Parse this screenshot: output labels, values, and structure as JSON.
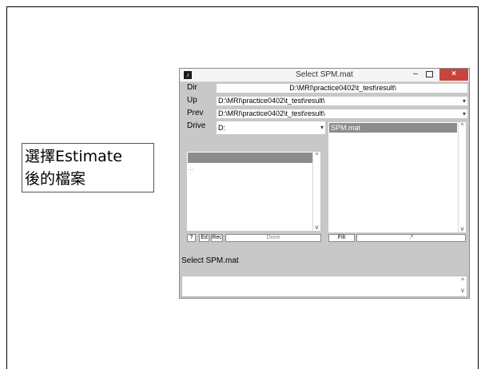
{
  "callout": {
    "line1": "選擇Estimate",
    "line2": "後的檔案"
  },
  "window": {
    "title": "Select SPM.mat",
    "icon": "matlab-icon",
    "controls": {
      "minimize": "–",
      "maximize": "□",
      "close": "×"
    }
  },
  "rows": {
    "dir_label": "Dir",
    "dir_value": "D:\\MRI\\practice0402\\t_test\\result\\",
    "up_label": "Up",
    "up_value": "D:\\MRI\\practice0402\\t_test\\result\\",
    "prev_label": "Prev",
    "prev_value": "D:\\MRI\\practice0402\\t_test\\result\\",
    "drive_label": "Drive",
    "drive_value": "D:"
  },
  "left_list": {
    "items": [
      "",
      ".."
    ]
  },
  "right_list": {
    "items": [
      "SPM.mat"
    ]
  },
  "buttons": {
    "help": "?",
    "ed": "Ed",
    "rec": "Rec",
    "done": "Done",
    "filt": "Filt",
    "filter_value": ".*"
  },
  "status_text": "Select SPM.mat",
  "icons": {
    "dropdown": "▾",
    "scroll_up": "^",
    "scroll_down": "v"
  }
}
